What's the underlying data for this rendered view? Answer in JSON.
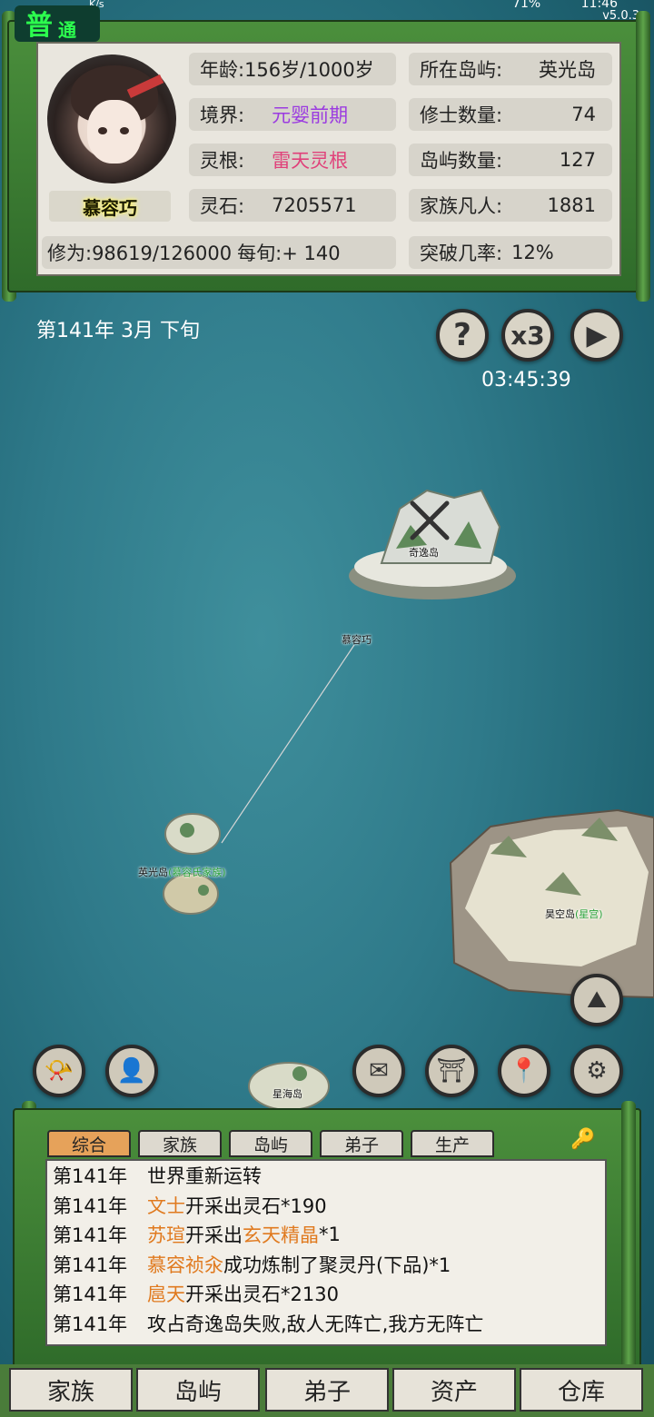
{
  "status": {
    "speed_unit": "K/s",
    "battery": "71%",
    "time": "11:46",
    "version": "v5.0.3"
  },
  "mode": {
    "big": "普",
    "small": "通"
  },
  "character": {
    "name": "慕容巧",
    "age": "年龄:156岁/1000岁",
    "realm_label": "境界:",
    "realm_value": "元婴前期",
    "root_label": "灵根:",
    "root_value": "雷天灵根",
    "stones_label": "灵石:",
    "stones_value": "7205571",
    "cultivation": "修为:98619/126000",
    "per_tick": "每旬:+ 140"
  },
  "stats": {
    "island_label": "所在岛屿:",
    "island_value": "英光岛",
    "cultivators_label": "修士数量:",
    "cultivators_value": "74",
    "islands_label": "岛屿数量:",
    "islands_value": "127",
    "mortals_label": "家族凡人:",
    "mortals_value": "1881",
    "breakthrough_label": "突破几率:",
    "breakthrough_value": "12%"
  },
  "date": "第141年 3月 下旬",
  "controls": {
    "help": "?",
    "speed": "x3",
    "play": "▶",
    "timer": "03:45:39"
  },
  "map": {
    "island_qiyi": "奇逸岛",
    "marker_name": "慕容巧",
    "island_yingguang": "英光岛",
    "yingguang_owner": "(慕容氏家族)",
    "island_haokong": "昊空岛",
    "haokong_owner": "(星宫)",
    "island_xinghai": "星海岛"
  },
  "log_tabs": [
    "综合",
    "家族",
    "岛屿",
    "弟子",
    "生产"
  ],
  "log": [
    {
      "year": "第141年",
      "parts": [
        [
          "世界重新运转",
          ""
        ]
      ]
    },
    {
      "year": "第141年",
      "parts": [
        [
          "文士",
          "hl"
        ],
        [
          "开采出灵石*190",
          ""
        ]
      ]
    },
    {
      "year": "第141年",
      "parts": [
        [
          "苏瑄",
          "hl"
        ],
        [
          "开采出",
          ""
        ],
        [
          "玄天精晶",
          "hl"
        ],
        [
          "*1",
          ""
        ]
      ]
    },
    {
      "year": "第141年",
      "parts": [
        [
          "慕容祯汆",
          "hl"
        ],
        [
          "成功炼制了聚灵丹(下品)*1",
          ""
        ]
      ]
    },
    {
      "year": "第141年",
      "parts": [
        [
          "扈天",
          "hl"
        ],
        [
          "开采出灵石*2130",
          ""
        ]
      ]
    },
    {
      "year": "第141年",
      "parts": [
        [
          "攻占奇逸岛失败,敌人无阵亡,我方无阵亡",
          ""
        ]
      ]
    }
  ],
  "nav": [
    "家族",
    "岛屿",
    "弟子",
    "资产",
    "仓库"
  ]
}
